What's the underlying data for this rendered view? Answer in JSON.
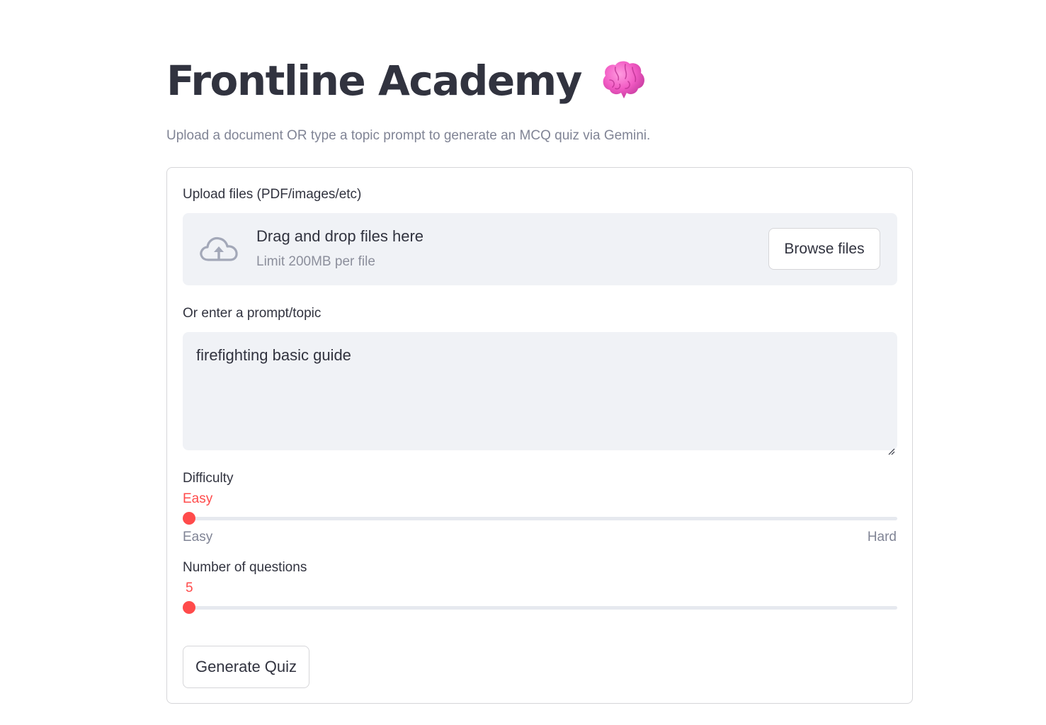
{
  "header": {
    "title": "Frontline Academy",
    "subtitle": "Upload a document OR type a topic prompt to generate an MCQ quiz via Gemini."
  },
  "upload": {
    "label": "Upload files (PDF/images/etc)",
    "drop_title": "Drag and drop files here",
    "drop_limit": "Limit 200MB per file",
    "browse_label": "Browse files"
  },
  "prompt": {
    "label": "Or enter a prompt/topic",
    "value": "firefighting basic guide"
  },
  "difficulty": {
    "label": "Difficulty",
    "value": "Easy",
    "min_label": "Easy",
    "max_label": "Hard",
    "fraction": 0
  },
  "questions": {
    "label": "Number of questions",
    "value": "5",
    "fraction": 0
  },
  "actions": {
    "generate_label": "Generate Quiz"
  },
  "colors": {
    "accent": "#ff4b4b",
    "text": "#31333f",
    "muted": "#808495",
    "input_bg": "#f0f2f6"
  },
  "icons": {
    "title_emoji": "brain-icon",
    "upload": "cloud-upload-icon"
  }
}
